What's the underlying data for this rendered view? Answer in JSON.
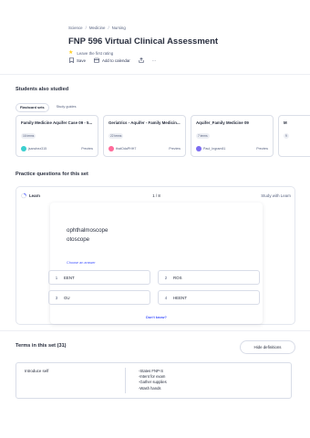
{
  "breadcrumb": [
    "Science",
    "Medicine",
    "Nursing"
  ],
  "title": "FNP 596 Virtual Clinical Assessment",
  "rating_text": "Leave the first rating",
  "actions": {
    "save": "Save",
    "add_calendar": "Add to calendar",
    "more": "···"
  },
  "students_also_studied": {
    "heading": "Students also studied",
    "tabs": [
      "Flashcard sets",
      "Study guides"
    ],
    "cards": [
      {
        "title": "Family Medicine Aquifer Case 09 - 5...",
        "terms": "16 terms",
        "author": "jsanchez315",
        "action": "Preview",
        "avatar_color": "#3ccfcf"
      },
      {
        "title": "Geriatrics - Aquifer - Family Medicin...",
        "terms": "22 terms",
        "author": "thatOdaPHH7",
        "action": "Preview",
        "avatar_color": "#ff6b9a"
      },
      {
        "title": "Aquifer_Family Medicine 09",
        "terms": "7 terms",
        "author": "Paul_Ingram81",
        "action": "Preview",
        "avatar_color": "#7c6cf0"
      },
      {
        "title": "M",
        "terms": "9",
        "author": "",
        "action": "",
        "avatar_color": "#4255ff"
      }
    ]
  },
  "practice": {
    "heading": "Practice questions for this set",
    "mode": "Learn",
    "counter": "1 / 8",
    "study_with": "Study with Learn",
    "prompt_lines": [
      "ophthalmoscope",
      "otoscope"
    ],
    "choose_label": "Choose an answer",
    "options": [
      {
        "num": "1",
        "label": "EENT"
      },
      {
        "num": "2",
        "label": "ROS"
      },
      {
        "num": "3",
        "label": "GU"
      },
      {
        "num": "4",
        "label": "HEENT"
      }
    ],
    "dont_know": "Don't know?"
  },
  "terms_section": {
    "heading": "Terms in this set (31)",
    "hide_button": "Hide definitions",
    "rows": [
      {
        "term": "Introduce self",
        "definition": [
          "-States FNP-S",
          "-Intent for exam",
          "-Gather supplies",
          "-Wash hands"
        ]
      }
    ]
  },
  "colors": {
    "accent": "#4255ff",
    "star": "#ffcd1f",
    "text": "#282e3e"
  }
}
